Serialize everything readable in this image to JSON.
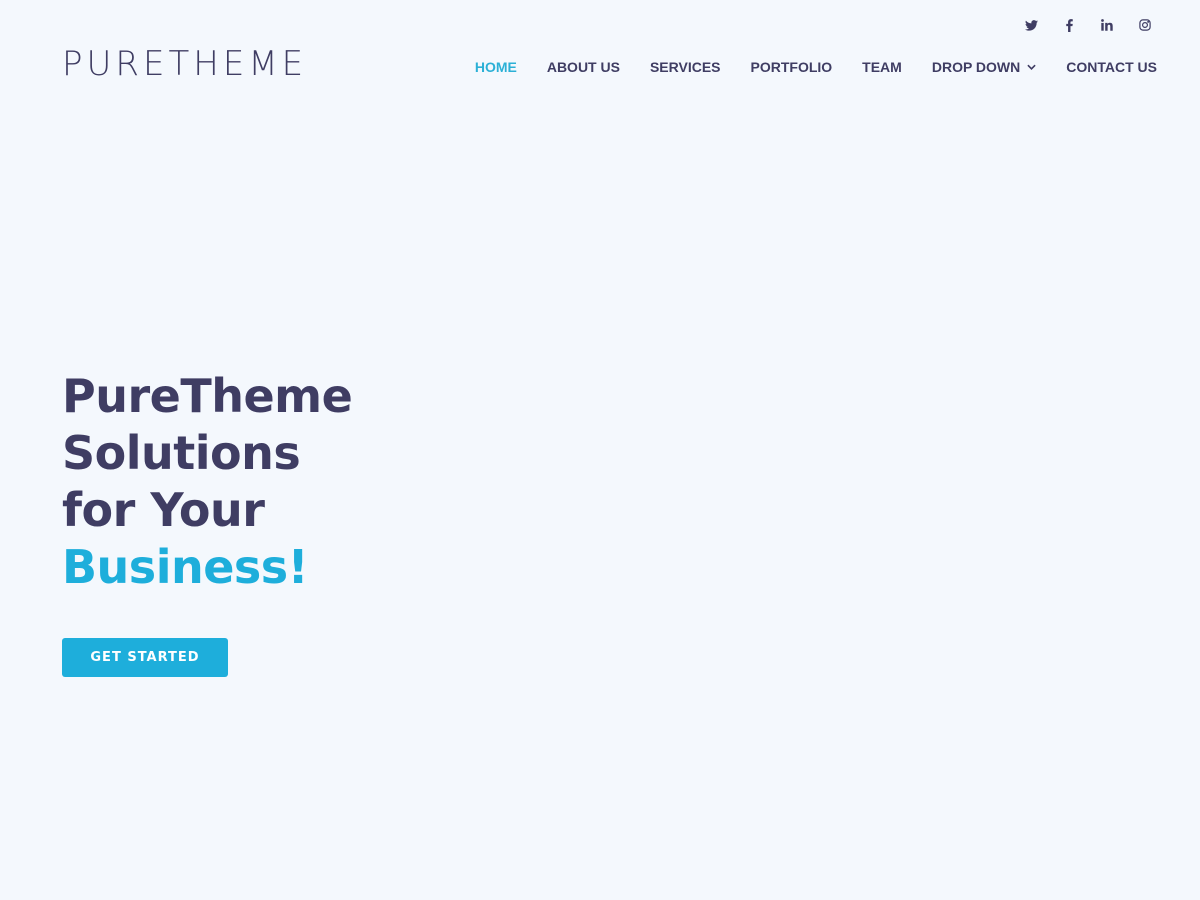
{
  "social": {
    "icons": [
      "twitter-icon",
      "facebook-icon",
      "linkedin-icon",
      "instagram-icon"
    ]
  },
  "header": {
    "logo": "PURETHEME"
  },
  "nav": {
    "items": [
      {
        "label": "HOME",
        "active": true
      },
      {
        "label": "ABOUT US",
        "active": false
      },
      {
        "label": "SERVICES",
        "active": false
      },
      {
        "label": "PORTFOLIO",
        "active": false
      },
      {
        "label": "TEAM",
        "active": false
      },
      {
        "label": "DROP DOWN",
        "active": false,
        "icon": "chevron-down-icon"
      },
      {
        "label": "CONTACT US",
        "active": false
      }
    ]
  },
  "hero": {
    "title_lines": [
      "PureTheme",
      "Solutions",
      "for Your",
      "Business!"
    ],
    "cta_label": "GET STARTED"
  },
  "colors": {
    "background": "#f4f8fd",
    "text": "#3f3d63",
    "accent": "#1eaedb"
  }
}
